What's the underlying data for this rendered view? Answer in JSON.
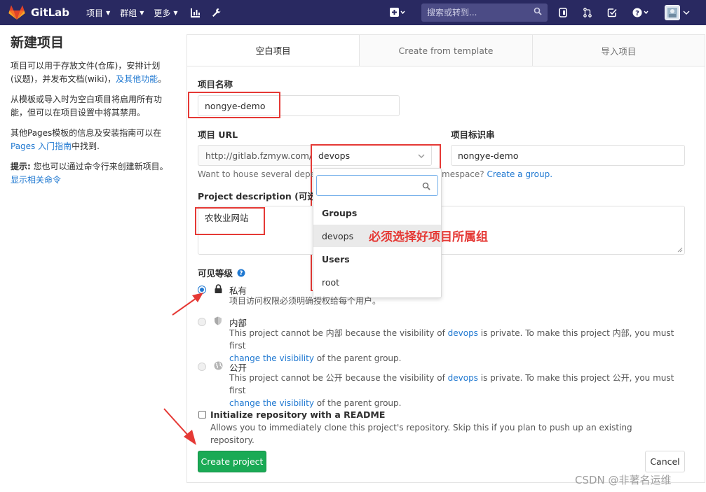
{
  "navbar": {
    "brand": "GitLab",
    "items": [
      {
        "label": "项目"
      },
      {
        "label": "群组"
      },
      {
        "label": "更多"
      }
    ],
    "search_placeholder": "搜索或转到..."
  },
  "sidebar": {
    "title": "新建项目",
    "p1_text": "项目可以用于存放文件(仓库)，安排计划(议题)，并发布文档(wiki)，",
    "p1_link": "及其他功能",
    "p1_end": "。",
    "p2_text": "从模板或导入时为空白项目将启用所有功能，但可以在项目设置中将其禁用。",
    "p3_text": "其他Pages模板的信息及安装指南可以在",
    "p3_link": "Pages 入门指南",
    "p3_end": "中找到.",
    "p4_label": "提示:",
    "p4_text": "您也可以通过命令行来创建新项目。",
    "p4_link": "显示相关命令"
  },
  "tabs": [
    {
      "label": "空白项目"
    },
    {
      "label": "Create from template"
    },
    {
      "label": "导入项目"
    }
  ],
  "form": {
    "name_label": "项目名称",
    "name_value": "nongye-demo",
    "url_label": "项目 URL",
    "url_prefix": "http://gitlab.fzmyw.com/",
    "namespace_value": "devops",
    "slug_label": "项目标识串",
    "slug_value": "nongye-demo",
    "namespace_help_a": "Want to house several depen",
    "namespace_help_b": "mespace?",
    "namespace_help_link": "Create a group.",
    "desc_label": "Project description (可选)",
    "desc_value": "农牧业网站",
    "visibility_label": "可见等级",
    "private_title": "私有",
    "private_desc": "项目访问权限必须明确授权给每个用户。",
    "internal_title": "内部",
    "internal_desc_a": "This project cannot be 内部 because the visibility of",
    "internal_desc_group": "devops",
    "internal_desc_b": "is private. To make this project 内部, you must first",
    "internal_desc_link": "change the visibility",
    "internal_desc_c": "of the parent group.",
    "public_title": "公开",
    "public_desc_a": "This project cannot be 公开 because the visibility of",
    "public_desc_group": "devops",
    "public_desc_b": "is private. To make this project 公开, you must first",
    "public_desc_link": "change the visibility",
    "public_desc_c": "of the parent group.",
    "readme_label": "Initialize repository with a README",
    "readme_desc": "Allows you to immediately clone this project's repository. Skip this if you plan to push up an existing repository.",
    "create_button": "Create project",
    "cancel_button": "Cancel"
  },
  "dropdown": {
    "groups_header": "Groups",
    "group_item": "devops",
    "users_header": "Users",
    "user_item": "root"
  },
  "annotation": "必须选择好项目所属组",
  "watermark": "CSDN @非著名运维",
  "colors": {
    "navbar": "#292961",
    "accent": "#1f78d1",
    "annotation": "#e53935",
    "create": "#1aaa55"
  }
}
